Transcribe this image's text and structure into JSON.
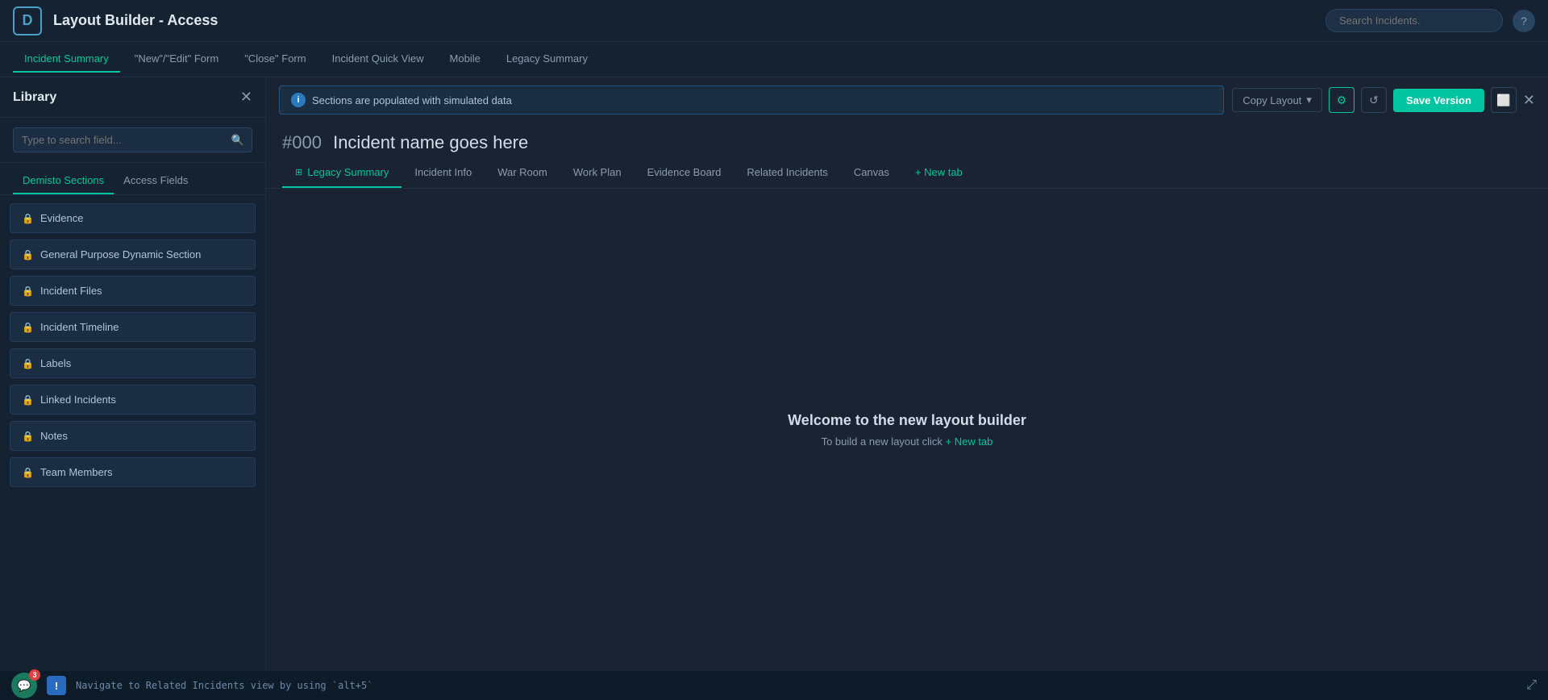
{
  "header": {
    "title": "Layout Builder - Access",
    "search_placeholder": "Search Incidents.",
    "help_label": "?"
  },
  "nav_tabs": [
    {
      "id": "incident-summary",
      "label": "Incident Summary",
      "active": true
    },
    {
      "id": "new-edit-form",
      "label": "\"New\"/\"Edit\" Form",
      "active": false
    },
    {
      "id": "close-form",
      "label": "\"Close\" Form",
      "active": false
    },
    {
      "id": "incident-quick-view",
      "label": "Incident Quick View",
      "active": false
    },
    {
      "id": "mobile",
      "label": "Mobile",
      "active": false
    },
    {
      "id": "legacy-summary",
      "label": "Legacy Summary",
      "active": false
    }
  ],
  "sidebar": {
    "title": "Library",
    "search_placeholder": "Type to search field...",
    "sub_tabs": [
      {
        "id": "demisto-sections",
        "label": "Demisto Sections",
        "active": true
      },
      {
        "id": "access-fields",
        "label": "Access Fields",
        "active": false
      }
    ],
    "items": [
      {
        "id": "evidence",
        "label": "Evidence"
      },
      {
        "id": "general-purpose-dynamic-section",
        "label": "General Purpose Dynamic Section"
      },
      {
        "id": "incident-files",
        "label": "Incident Files"
      },
      {
        "id": "incident-timeline",
        "label": "Incident Timeline"
      },
      {
        "id": "labels",
        "label": "Labels"
      },
      {
        "id": "linked-incidents",
        "label": "Linked Incidents"
      },
      {
        "id": "notes",
        "label": "Notes"
      },
      {
        "id": "team-members",
        "label": "Team Members"
      }
    ]
  },
  "toolbar": {
    "info_message": "Sections are populated with simulated data",
    "copy_layout_label": "Copy Layout",
    "save_version_label": "Save Version"
  },
  "incident": {
    "number": "#000",
    "name": "Incident name goes here"
  },
  "inner_tabs": [
    {
      "id": "legacy-summary",
      "label": "Legacy Summary",
      "active": true,
      "has_icon": true
    },
    {
      "id": "incident-info",
      "label": "Incident Info",
      "active": false
    },
    {
      "id": "war-room",
      "label": "War Room",
      "active": false
    },
    {
      "id": "work-plan",
      "label": "Work Plan",
      "active": false
    },
    {
      "id": "evidence-board",
      "label": "Evidence Board",
      "active": false
    },
    {
      "id": "related-incidents",
      "label": "Related Incidents",
      "active": false
    },
    {
      "id": "canvas",
      "label": "Canvas",
      "active": false
    },
    {
      "id": "new-tab",
      "label": "+ New tab",
      "active": false
    }
  ],
  "canvas": {
    "welcome_title": "Welcome to the new layout builder",
    "welcome_sub_prefix": "To build a new layout click ",
    "welcome_sub_link": "+ New tab"
  },
  "status_bar": {
    "chat_badge": "3",
    "message": "Navigate to Related Incidents view by using `alt+5`",
    "expand_icon": "M↗"
  }
}
